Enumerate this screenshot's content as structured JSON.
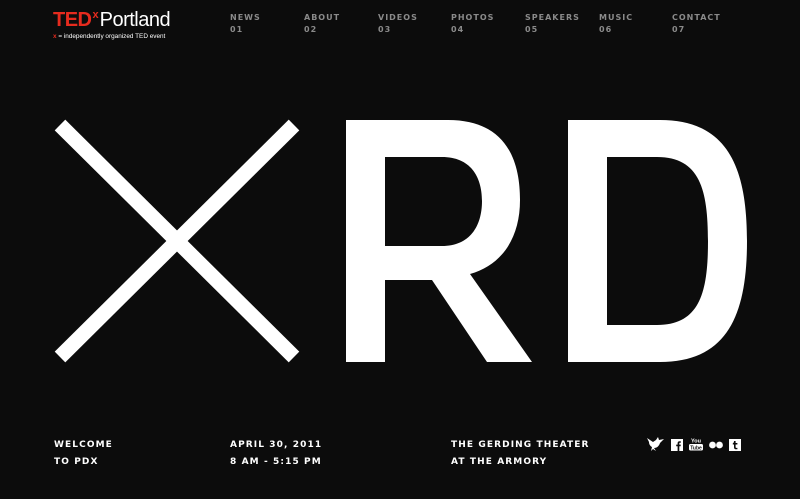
{
  "logo": {
    "brand": "TED",
    "x": "x",
    "city": "Portland",
    "tagline_mark": "x",
    "tagline": " = independently organized TED event"
  },
  "nav": [
    {
      "label": "NEWS",
      "number": "01"
    },
    {
      "label": "ABOUT",
      "number": "02"
    },
    {
      "label": "VIDEOS",
      "number": "03"
    },
    {
      "label": "PHOTOS",
      "number": "04"
    },
    {
      "label": "SPEAKERS",
      "number": "05"
    },
    {
      "label": "MUSIC",
      "number": "06"
    },
    {
      "label": "CONTACT",
      "number": "07"
    }
  ],
  "hero": {
    "letters": "RD",
    "mark": "X"
  },
  "info": {
    "welcome": [
      "WELCOME",
      "TO PDX"
    ],
    "date": [
      "APRIL 30, 2011",
      "8 AM - 5:15 PM"
    ],
    "venue": [
      "THE GERDING THEATER",
      "AT THE ARMORY"
    ]
  },
  "social": [
    {
      "name": "twitter-bird-icon"
    },
    {
      "name": "facebook-icon"
    },
    {
      "name": "youtube-icon"
    },
    {
      "name": "flickr-icon"
    },
    {
      "name": "tumblr-icon"
    }
  ],
  "colors": {
    "background": "#0c0c0c",
    "accent_red": "#e62b1e",
    "nav_gray": "#8a8a8a",
    "text": "#ffffff"
  }
}
